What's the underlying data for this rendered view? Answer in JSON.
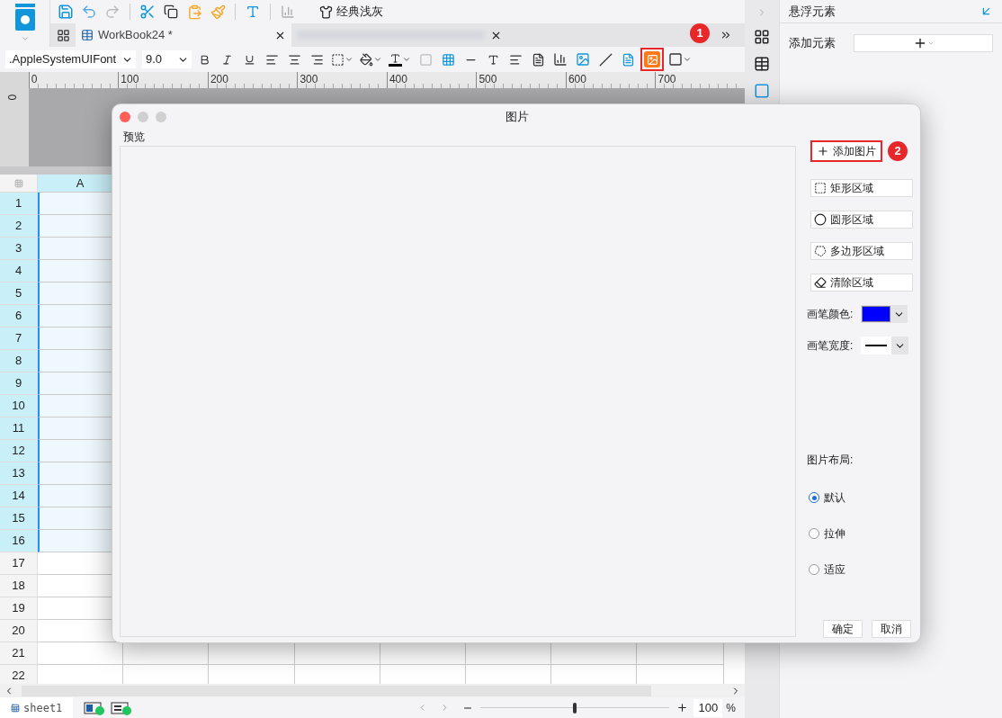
{
  "toolbar": {
    "theme_label": "经典浅灰"
  },
  "tabs": [
    {
      "label": "WorkBook24 *",
      "selected": true
    }
  ],
  "format_bar": {
    "font": ".AppleSystemUIFont",
    "size": "9.0",
    "image_tool_highlighted": true
  },
  "callouts": [
    "1",
    "2"
  ],
  "ruler": {
    "marks": [
      "0",
      "100",
      "200",
      "300",
      "400",
      "500",
      "600",
      "700"
    ],
    "vertical_mark": "0"
  },
  "sheet": {
    "columns": [
      {
        "label": "A",
        "selected": true
      }
    ],
    "rows": [
      {
        "label": "1",
        "selected": true
      },
      {
        "label": "2",
        "selected": true
      },
      {
        "label": "3",
        "selected": true
      },
      {
        "label": "4",
        "selected": true
      },
      {
        "label": "5",
        "selected": true
      },
      {
        "label": "6",
        "selected": true
      },
      {
        "label": "7",
        "selected": true
      },
      {
        "label": "8",
        "selected": true
      },
      {
        "label": "9",
        "selected": true
      },
      {
        "label": "10",
        "selected": true
      },
      {
        "label": "11",
        "selected": true
      },
      {
        "label": "12",
        "selected": true
      },
      {
        "label": "13",
        "selected": true
      },
      {
        "label": "14",
        "selected": true
      },
      {
        "label": "15",
        "selected": true
      },
      {
        "label": "16",
        "selected": true
      },
      {
        "label": "17",
        "selected": false
      },
      {
        "label": "18",
        "selected": false
      },
      {
        "label": "19",
        "selected": false
      },
      {
        "label": "20",
        "selected": false
      },
      {
        "label": "21",
        "selected": false
      },
      {
        "label": "22",
        "selected": false
      }
    ]
  },
  "sheet_tabs": [
    {
      "label": "sheet1",
      "selected": true
    }
  ],
  "zoom": {
    "value": "100",
    "unit": "%",
    "level": 0.5
  },
  "side_panel": {
    "title": "悬浮元素",
    "add_label": "添加元素"
  },
  "dialog": {
    "title": "图片",
    "preview_label": "预览",
    "add_button": "添加图片",
    "region_buttons": [
      {
        "kind": "rect",
        "label": "矩形区域"
      },
      {
        "kind": "circle",
        "label": "圆形区域"
      },
      {
        "kind": "polygon",
        "label": "多边形区域"
      },
      {
        "kind": "clear",
        "label": "清除区域"
      }
    ],
    "pen_color": {
      "label": "画笔颜色:",
      "color": "#0000ff"
    },
    "pen_width": {
      "label": "画笔宽度:"
    },
    "layout": {
      "label": "图片布局:",
      "options": [
        {
          "label": "默认",
          "selected": true
        },
        {
          "label": "拉伸",
          "selected": false
        },
        {
          "label": "适应",
          "selected": false
        }
      ]
    },
    "buttons": [
      "确定",
      "取消"
    ]
  }
}
